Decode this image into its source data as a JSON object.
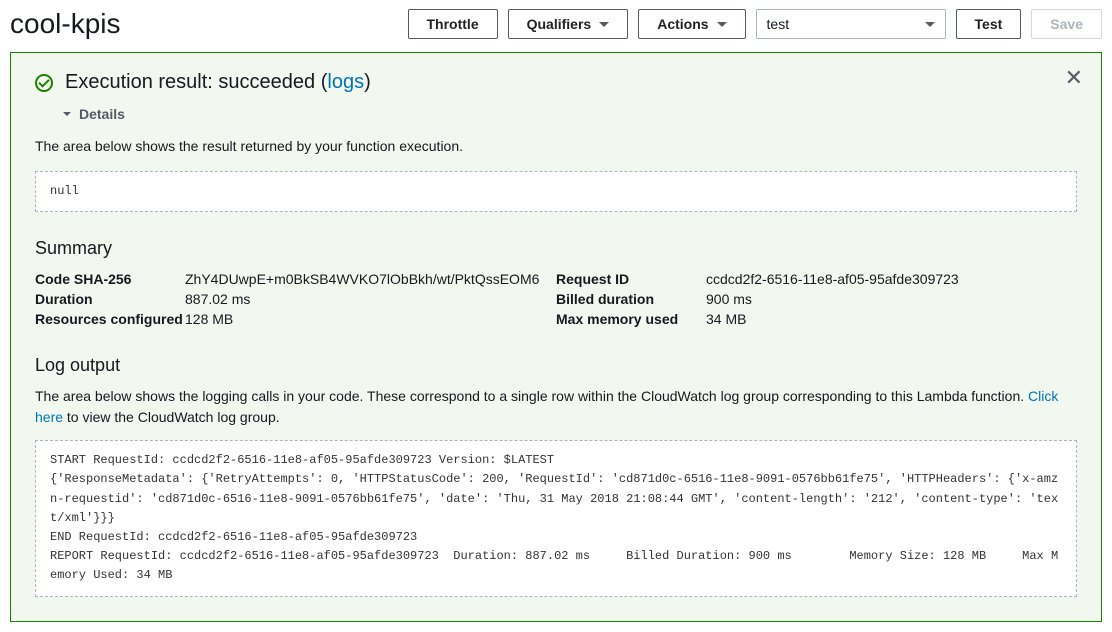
{
  "header": {
    "function_name": "cool-kpis",
    "throttle_label": "Throttle",
    "qualifiers_label": "Qualifiers",
    "actions_label": "Actions",
    "test_event_selected": "test",
    "test_label": "Test",
    "save_label": "Save"
  },
  "result": {
    "title_prefix": "Execution result: succeeded (",
    "logs_link": "logs",
    "title_suffix": ")",
    "details_label": "Details",
    "result_desc": "The area below shows the result returned by your function execution.",
    "return_value": "null"
  },
  "summary": {
    "heading": "Summary",
    "left": [
      {
        "label": "Code SHA-256",
        "value": "ZhY4DUwpE+m0BkSB4WVKO7lObBkh/wt/PktQssEOM6"
      },
      {
        "label": "Duration",
        "value": "887.02 ms"
      },
      {
        "label": "Resources configured",
        "value": "128 MB"
      }
    ],
    "right": [
      {
        "label": "Request ID",
        "value": "ccdcd2f2-6516-11e8-af05-95afde309723"
      },
      {
        "label": "Billed duration",
        "value": "900 ms"
      },
      {
        "label": "Max memory used",
        "value": "34 MB"
      }
    ]
  },
  "log": {
    "heading": "Log output",
    "desc_prefix": "The area below shows the logging calls in your code. These correspond to a single row within the CloudWatch log group corresponding to this Lambda function. ",
    "click_here": "Click here",
    "desc_suffix": " to view the CloudWatch log group.",
    "content": "START RequestId: ccdcd2f2-6516-11e8-af05-95afde309723 Version: $LATEST\n{'ResponseMetadata': {'RetryAttempts': 0, 'HTTPStatusCode': 200, 'RequestId': 'cd871d0c-6516-11e8-9091-0576bb61fe75', 'HTTPHeaders': {'x-amzn-requestid': 'cd871d0c-6516-11e8-9091-0576bb61fe75', 'date': 'Thu, 31 May 2018 21:08:44 GMT', 'content-length': '212', 'content-type': 'text/xml'}}}\nEND RequestId: ccdcd2f2-6516-11e8-af05-95afde309723\nREPORT RequestId: ccdcd2f2-6516-11e8-af05-95afde309723  Duration: 887.02 ms     Billed Duration: 900 ms        Memory Size: 128 MB     Max Memory Used: 34 MB"
  }
}
